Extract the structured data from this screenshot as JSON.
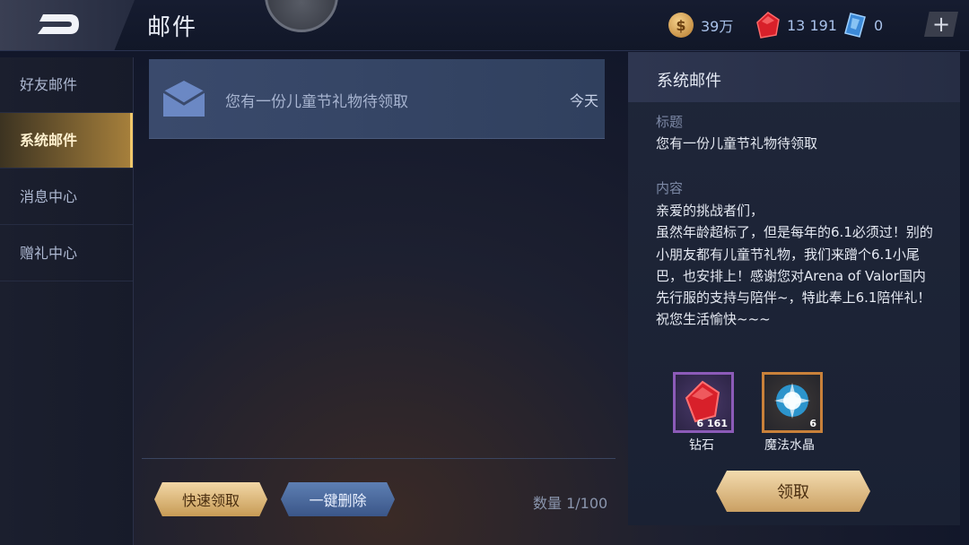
{
  "header": {
    "title": "邮件",
    "back_icon": "back-arrow-icon",
    "currencies": {
      "gold": "39万",
      "ruby": "13 191",
      "crystal": "0"
    },
    "plus_label": "+"
  },
  "sidebar": {
    "items": [
      {
        "label": "好友邮件",
        "active": false
      },
      {
        "label": "系统邮件",
        "active": true
      },
      {
        "label": "消息中心",
        "active": false
      },
      {
        "label": "赠礼中心",
        "active": false
      }
    ]
  },
  "mail_list": {
    "items": [
      {
        "subject": "您有一份儿童节礼物待领取",
        "date": "今天",
        "icon": "envelope-icon"
      }
    ],
    "quick_claim_label": "快速领取",
    "delete_all_label": "一键删除",
    "count_label": "数量 1/100"
  },
  "detail": {
    "header": "系统邮件",
    "subject_label": "标题",
    "subject": "您有一份儿童节礼物待领取",
    "content_label": "内容",
    "body": "亲爱的挑战者们，\n虽然年龄超标了，但是每年的6.1必须过！别的小朋友都有儿童节礼物，我们来蹭个6.1小尾巴，也安排上！感谢您对Arena of Valor国内先行服的支持与陪伴~，特此奉上6.1陪伴礼！祝您生活愉快~~~",
    "rewards": [
      {
        "name": "钻石",
        "quantity": "6 161",
        "icon": "ruby-icon"
      },
      {
        "name": "魔法水晶",
        "quantity": "6",
        "icon": "magic-crystal-icon"
      }
    ],
    "claim_label": "领取"
  },
  "colors": {
    "gold_accent": "#c79b55",
    "blue_button": "#3b5688",
    "active_tab": "#a8813c"
  }
}
